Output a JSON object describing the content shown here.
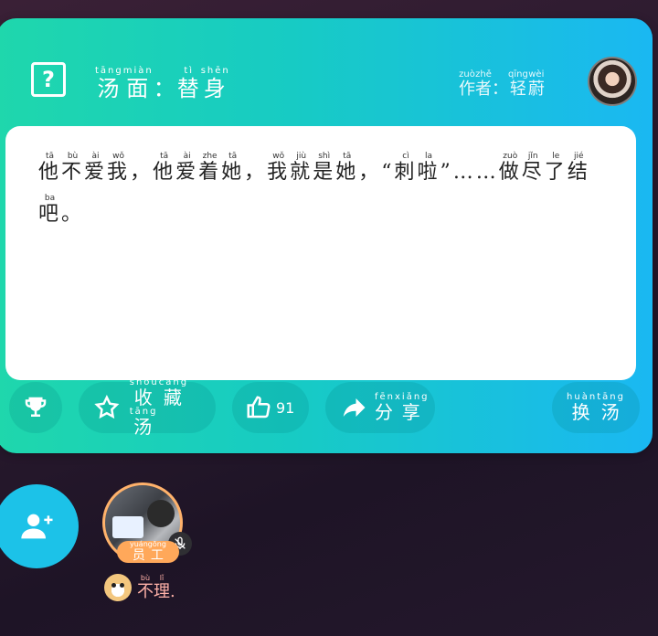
{
  "header": {
    "help_symbol": "?",
    "title": [
      {
        "c": "汤",
        "py": "tāng"
      },
      {
        "c": "面",
        "py": "miàn"
      },
      {
        "c": "：",
        "py": ""
      },
      {
        "c": "替",
        "py": "tì"
      },
      {
        "c": "身",
        "py": "shēn"
      }
    ],
    "author": [
      {
        "c": "作",
        "py": "zuò"
      },
      {
        "c": "者",
        "py": "zhě"
      },
      {
        "c": "：",
        "py": ""
      },
      {
        "c": "轻",
        "py": "qīng"
      },
      {
        "c": "蔚",
        "py": "wèi"
      }
    ]
  },
  "soup_text": [
    {
      "c": "他",
      "py": "tā"
    },
    {
      "c": "不",
      "py": "bù"
    },
    {
      "c": "爱",
      "py": "ài"
    },
    {
      "c": "我",
      "py": "wǒ"
    },
    {
      "c": "，",
      "py": ""
    },
    {
      "c": "他",
      "py": "tā"
    },
    {
      "c": "爱",
      "py": "ài"
    },
    {
      "c": "着",
      "py": "zhe"
    },
    {
      "c": "她",
      "py": "tā"
    },
    {
      "c": "，",
      "py": ""
    },
    {
      "c": "我",
      "py": "wǒ"
    },
    {
      "c": "就",
      "py": "jiù"
    },
    {
      "c": "是",
      "py": "shì"
    },
    {
      "c": "她",
      "py": "tā"
    },
    {
      "c": "，",
      "py": ""
    },
    {
      "c": "“",
      "py": ""
    },
    {
      "c": "刺",
      "py": "cì"
    },
    {
      "c": "啦",
      "py": "la"
    },
    {
      "c": "”……",
      "py": ""
    },
    {
      "c": "做",
      "py": "zuò"
    },
    {
      "c": "尽",
      "py": "jǐn"
    },
    {
      "c": "了",
      "py": "le"
    },
    {
      "c": "结",
      "py": "jié"
    },
    {
      "c": "吧",
      "py": "ba"
    },
    {
      "c": "。",
      "py": ""
    }
  ],
  "actions": {
    "favorite": [
      {
        "c": "收",
        "py": "shōu"
      },
      {
        "c": "藏",
        "py": "cáng"
      },
      {
        "c": "汤",
        "py": "tāng"
      }
    ],
    "like_count": "91",
    "share": [
      {
        "c": "分",
        "py": "fēn"
      },
      {
        "c": "享",
        "py": "xiǎng"
      }
    ],
    "swap": [
      {
        "c": "换",
        "py": "huàn"
      },
      {
        "c": "汤",
        "py": "tāng"
      }
    ]
  },
  "participant": {
    "role": [
      {
        "c": "员",
        "py": "yuán"
      },
      {
        "c": "工",
        "py": "gōng"
      }
    ],
    "name": [
      {
        "c": "不",
        "py": "bù"
      },
      {
        "c": "理",
        "py": "lǐ"
      },
      {
        "c": ".",
        "py": ""
      }
    ]
  },
  "icons": [
    "help-icon",
    "trophy-icon",
    "star-icon",
    "thumbs-up-icon",
    "share-arrow-icon",
    "add-user-icon",
    "mic-muted-icon",
    "dog-emoji-icon"
  ],
  "colors": {
    "card_start": "#1fd7ac",
    "card_end": "#1ab8f2",
    "badge": "#ffa85a",
    "add_button": "#1cc2e8"
  }
}
